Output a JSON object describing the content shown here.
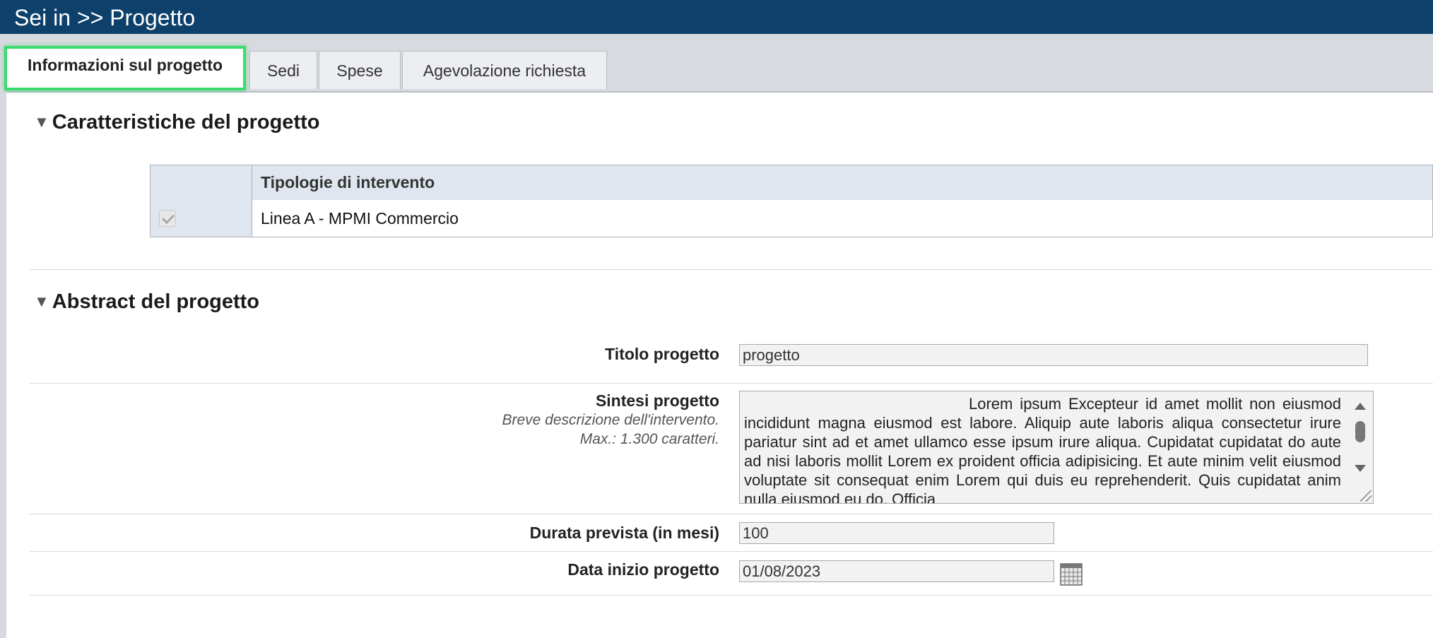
{
  "header": {
    "breadcrumb": "Sei in >> Progetto"
  },
  "tabs": [
    {
      "label": "Informazioni sul progetto",
      "active": true
    },
    {
      "label": "Sedi",
      "active": false
    },
    {
      "label": "Spese",
      "active": false
    },
    {
      "label": "Agevolazione richiesta",
      "active": false
    }
  ],
  "section1": {
    "title": "Caratteristiche del progetto",
    "table": {
      "header": "Tipologie di intervento",
      "rows": [
        {
          "checked": true,
          "label": "Linea A - MPMI Commercio"
        }
      ]
    }
  },
  "section2": {
    "title": "Abstract del progetto",
    "titolo": {
      "label": "Titolo progetto",
      "value": "progetto"
    },
    "sintesi": {
      "label": "Sintesi progetto",
      "hint1": "Breve descrizione dell'intervento.",
      "hint2": "Max.: 1.300 caratteri.",
      "value": "Lorem ipsum Excepteur id amet mollit non eiusmod incididunt magna eiusmod est labore. Aliquip aute laboris aliqua consectetur irure pariatur sint ad et amet ullamco esse ipsum irure aliqua. Cupidatat cupidatat do aute ad nisi laboris mollit Lorem ex proident officia adipisicing. Et aute minim velit eiusmod voluptate sit consequat enim Lorem qui duis eu reprehenderit. Quis cupidatat anim nulla eiusmod eu do. Officia"
    },
    "durata": {
      "label": "Durata prevista (in mesi)",
      "value": "100"
    },
    "data_inizio": {
      "label": "Data inizio progetto",
      "value": "01/08/2023"
    }
  },
  "icons": {
    "collapse": "triangle-down-icon",
    "calendar": "calendar-icon"
  },
  "colors": {
    "header_bg": "#0e406c",
    "active_tab_outline": "#3bdc6d"
  }
}
